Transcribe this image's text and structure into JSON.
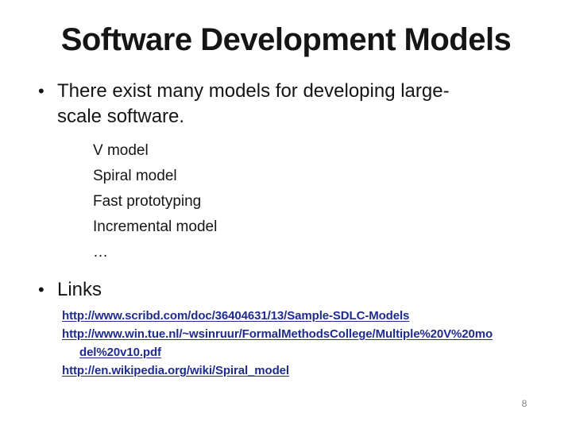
{
  "slide": {
    "title": "Software Development Models",
    "bullets": [
      {
        "marker": "•",
        "lines": [
          "There exist many models for developing large-",
          "scale software."
        ]
      },
      {
        "marker": "•",
        "lines": [
          "Links"
        ]
      }
    ],
    "sub_items": [
      "V model",
      "Spiral model",
      "Fast prototyping",
      "Incremental model",
      "…"
    ],
    "links": [
      {
        "url": "http://www.scribd.com/doc/36404631/13/Sample-SDLC-Models",
        "lines": [
          "http://www.scribd.com/doc/36404631/13/Sample-SDLC-Models"
        ]
      },
      {
        "url": "http://www.win.tue.nl/~wsinruur/FormalMethodsCollege/Multiple%20V%20model%20v10.pdf",
        "lines": [
          "http://www.win.tue.nl/~wsinruur/FormalMethodsCollege/Multiple%20V%20mo",
          "del%20v10.pdf"
        ]
      },
      {
        "url": "http://en.wikipedia.org/wiki/Spiral_model",
        "lines": [
          "http://en.wikipedia.org/wiki/Spiral_model"
        ]
      }
    ],
    "page_number": "8",
    "colors": {
      "background": "#ffffff",
      "text": "#151515",
      "link": "#202c8c",
      "page_number": "#8a8a8a"
    }
  }
}
